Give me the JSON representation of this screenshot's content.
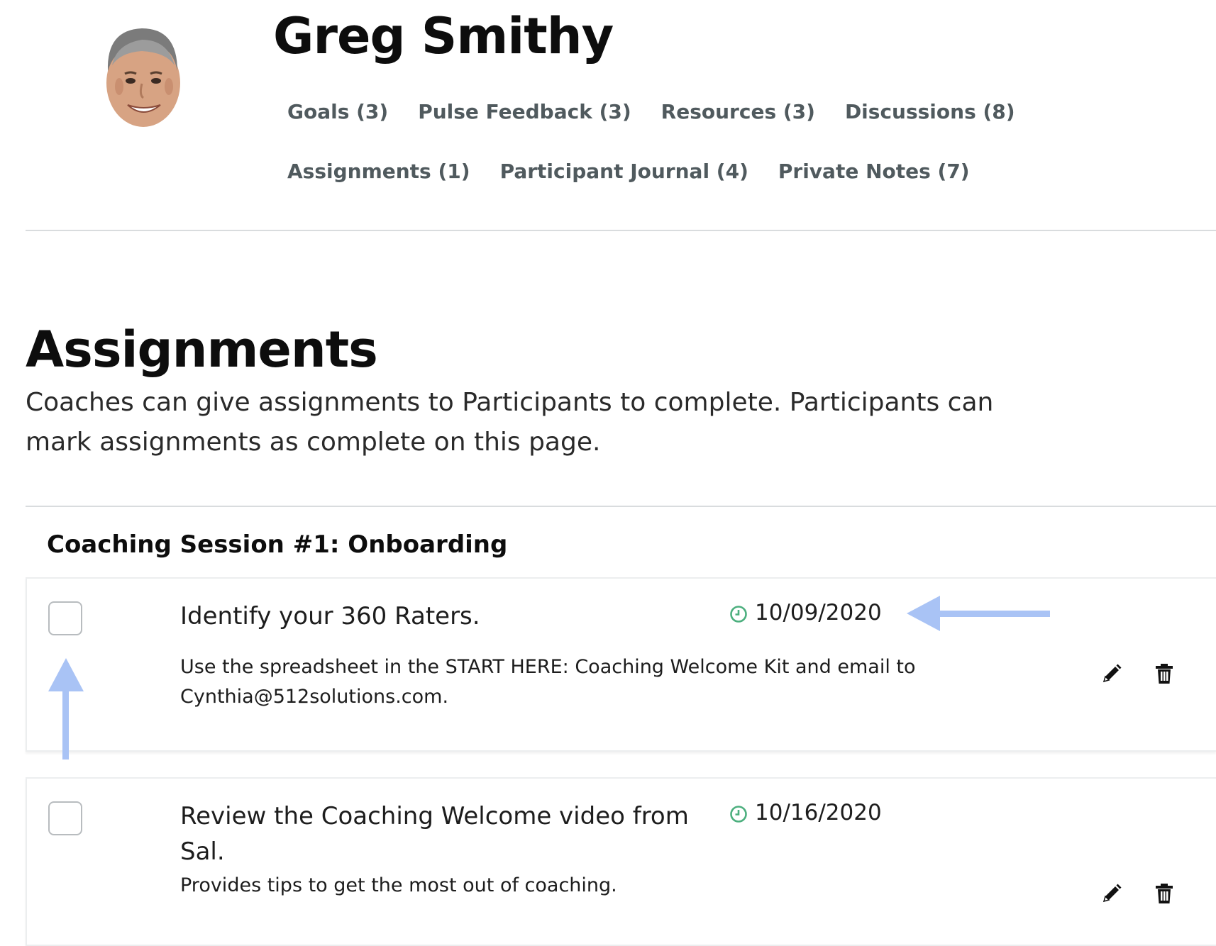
{
  "profile": {
    "name": "Greg Smithy",
    "avatar_alt": "profile photo"
  },
  "nav": {
    "items": [
      {
        "label": "Goals (3)"
      },
      {
        "label": "Pulse Feedback (3)"
      },
      {
        "label": "Resources (3)"
      },
      {
        "label": "Discussions (8)"
      },
      {
        "label": "Assignments (1)"
      },
      {
        "label": "Participant Journal (4)"
      },
      {
        "label": "Private Notes (7)"
      }
    ]
  },
  "page": {
    "title": "Assignments",
    "description": "Coaches can give assignments to Participants to complete. Participants can mark assignments as complete on this page."
  },
  "session": {
    "title": "Coaching Session #1: Onboarding",
    "assignments": [
      {
        "title": "Identify your 360 Raters.",
        "due": "10/09/2020",
        "note": "Use the spreadsheet in the START HERE: Coaching Welcome Kit and email to Cynthia@512solutions.com.",
        "completed": false
      },
      {
        "title": "Review the Coaching Welcome video from Sal.",
        "due": "10/16/2020",
        "note": "Provides tips to get the most out of coaching.",
        "completed": false
      }
    ]
  },
  "icons": {
    "clock": "clock-icon",
    "edit": "pencil-icon",
    "delete": "trash-icon",
    "annotation": "arrow-annotation"
  },
  "colors": {
    "nav_text": "#505a5e",
    "clock_green": "#4caf7e",
    "annotation_arrow": "#a9c3f5"
  }
}
